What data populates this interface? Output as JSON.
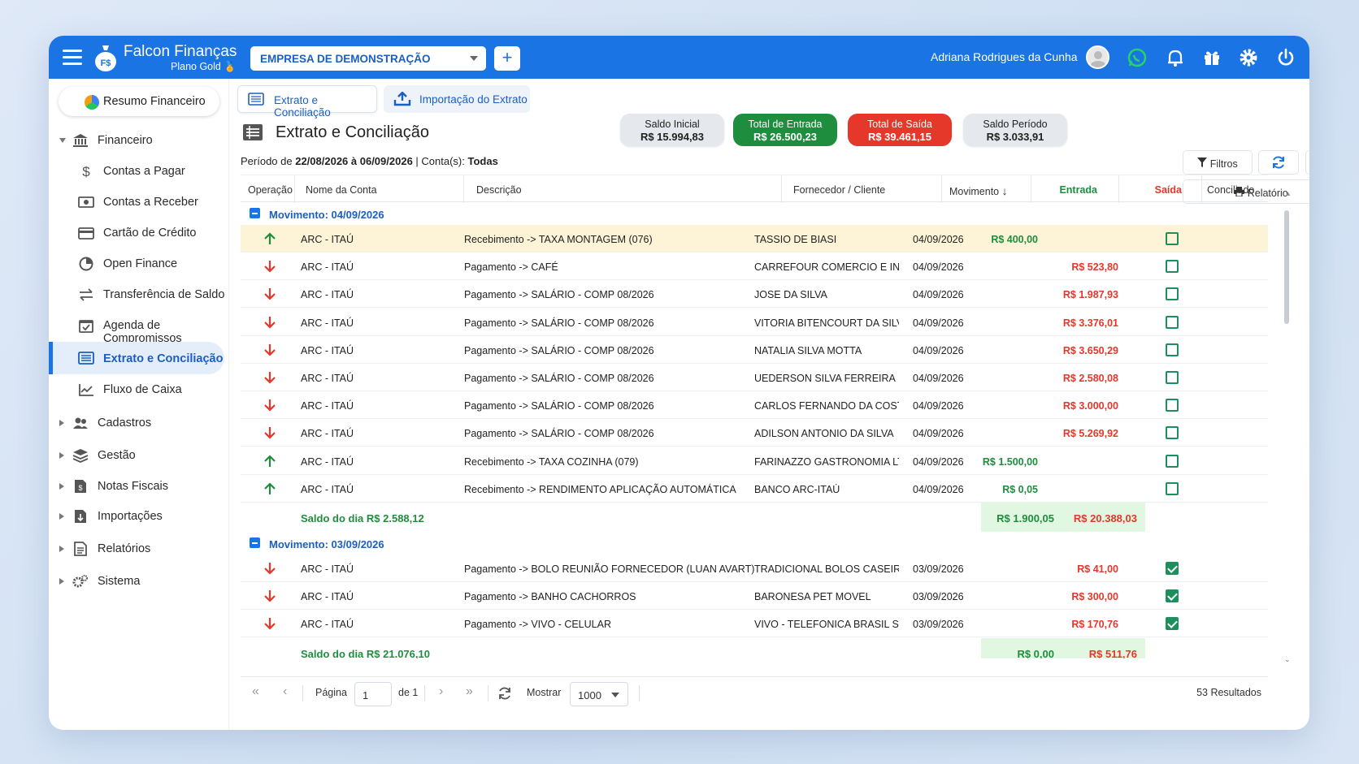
{
  "app": {
    "brand": "Falcon Finanças",
    "plan": "Plano Gold",
    "company": "EMPRESA DE DEMONSTRAÇÃO",
    "add": "+",
    "user": "Adriana Rodrigues da Cunha"
  },
  "sidebar": {
    "resumo": "Resumo Financeiro",
    "financeiro": "Financeiro",
    "items": [
      "Contas a Pagar",
      "Contas a Receber",
      "Cartão de Crédito",
      "Open Finance",
      "Transferência de Saldo",
      "Agenda de Compromissos",
      "Extrato e Conciliação",
      "Fluxo de Caixa"
    ],
    "groups": [
      "Cadastros",
      "Gestão",
      "Notas Fiscais",
      "Importações",
      "Relatórios",
      "Sistema"
    ]
  },
  "tabs": [
    "Extrato e Conciliação",
    "Importação do Extrato"
  ],
  "page": {
    "title": "Extrato e Conciliação",
    "period_prefix": "Período de ",
    "period_range": "22/08/2026 à 06/09/2026",
    "accounts_prefix": " | Conta(s): ",
    "accounts": "Todas"
  },
  "summary": {
    "saldo_inicial_label": "Saldo Inicial",
    "saldo_inicial": "R$ 15.994,83",
    "entrada_label": "Total de Entrada",
    "entrada": "R$ 26.500,23",
    "saida_label": "Total de Saída",
    "saida": "R$ 39.461,15",
    "periodo_label": "Saldo Período",
    "periodo": "R$ 3.033,91"
  },
  "toolbar": {
    "filtros": "Filtros",
    "relatorio": "Relatório"
  },
  "columns": {
    "operacao": "Operação",
    "conta": "Nome da Conta",
    "descricao": "Descrição",
    "fornecedor": "Fornecedor / Cliente",
    "movimento": "Movimento",
    "entrada": "Entrada",
    "saida": "Saída",
    "conciliado": "Conciliado"
  },
  "groups": [
    {
      "label": "Movimento: 04/09/2026",
      "rows": [
        {
          "op": "in",
          "conta": "ARC - ITAÚ",
          "desc": "Recebimento -> TAXA MONTAGEM (076)",
          "cliente": "TASSIO DE BIASI",
          "data": "04/09/2026",
          "entrada": "R$ 400,00",
          "saida": "",
          "conciliado": false,
          "highlight": true
        },
        {
          "op": "out",
          "conta": "ARC - ITAÚ",
          "desc": "Pagamento -> CAFÉ",
          "cliente": "CARREFOUR COMERCIO E INDUSTF",
          "data": "04/09/2026",
          "entrada": "",
          "saida": "R$ 523,80",
          "conciliado": false
        },
        {
          "op": "out",
          "conta": "ARC - ITAÚ",
          "desc": "Pagamento -> SALÁRIO - COMP 08/2026",
          "cliente": "JOSE DA SILVA",
          "data": "04/09/2026",
          "entrada": "",
          "saida": "R$ 1.987,93",
          "conciliado": false
        },
        {
          "op": "out",
          "conta": "ARC - ITAÚ",
          "desc": "Pagamento -> SALÁRIO - COMP 08/2026",
          "cliente": "VITORIA BITENCOURT DA SILVA",
          "data": "04/09/2026",
          "entrada": "",
          "saida": "R$ 3.376,01",
          "conciliado": false
        },
        {
          "op": "out",
          "conta": "ARC - ITAÚ",
          "desc": "Pagamento -> SALÁRIO - COMP 08/2026",
          "cliente": "NATALIA SILVA MOTTA",
          "data": "04/09/2026",
          "entrada": "",
          "saida": "R$ 3.650,29",
          "conciliado": false
        },
        {
          "op": "out",
          "conta": "ARC - ITAÚ",
          "desc": "Pagamento -> SALÁRIO - COMP 08/2026",
          "cliente": "UEDERSON SILVA FERREIRA",
          "data": "04/09/2026",
          "entrada": "",
          "saida": "R$ 2.580,08",
          "conciliado": false
        },
        {
          "op": "out",
          "conta": "ARC - ITAÚ",
          "desc": "Pagamento -> SALÁRIO - COMP 08/2026",
          "cliente": "CARLOS FERNANDO DA COSTA",
          "data": "04/09/2026",
          "entrada": "",
          "saida": "R$ 3.000,00",
          "conciliado": false
        },
        {
          "op": "out",
          "conta": "ARC - ITAÚ",
          "desc": "Pagamento -> SALÁRIO - COMP 08/2026",
          "cliente": "ADILSON ANTONIO DA SILVA",
          "data": "04/09/2026",
          "entrada": "",
          "saida": "R$ 5.269,92",
          "conciliado": false
        },
        {
          "op": "in",
          "conta": "ARC - ITAÚ",
          "desc": "Recebimento -> TAXA COZINHA (079)",
          "cliente": "FARINAZZO GASTRONOMIA LTDA",
          "data": "04/09/2026",
          "entrada": "R$ 1.500,00",
          "saida": "",
          "conciliado": false
        },
        {
          "op": "in",
          "conta": "ARC - ITAÚ",
          "desc": "Recebimento -> RENDIMENTO APLICAÇÃO AUTOMÁTICA",
          "cliente": "BANCO ARC-ITAÚ",
          "data": "04/09/2026",
          "entrada": "R$ 0,05",
          "saida": "",
          "conciliado": false
        }
      ],
      "saldo": "Saldo do dia R$ 2.588,12",
      "total_entrada": "R$ 1.900,05",
      "total_saida": "R$ 20.388,03"
    },
    {
      "label": "Movimento: 03/09/2026",
      "rows": [
        {
          "op": "out",
          "conta": "ARC - ITAÚ",
          "desc": "Pagamento -> BOLO REUNIÃO FORNECEDOR (LUAN AVART)",
          "cliente": "TRADICIONAL BOLOS CASEIROS",
          "data": "03/09/2026",
          "entrada": "",
          "saida": "R$ 41,00",
          "conciliado": true
        },
        {
          "op": "out",
          "conta": "ARC - ITAÚ",
          "desc": "Pagamento -> BANHO CACHORROS",
          "cliente": "BARONESA PET MOVEL",
          "data": "03/09/2026",
          "entrada": "",
          "saida": "R$ 300,00",
          "conciliado": true
        },
        {
          "op": "out",
          "conta": "ARC - ITAÚ",
          "desc": "Pagamento -> VIVO - CELULAR",
          "cliente": "VIVO - TELEFONICA BRASIL S.A.",
          "data": "03/09/2026",
          "entrada": "",
          "saida": "R$ 170,76",
          "conciliado": true
        }
      ],
      "saldo": "Saldo do dia R$ 21.076,10",
      "total_entrada": "R$ 0,00",
      "total_saida": "R$ 511,76"
    }
  ],
  "pager": {
    "page_label": "Página",
    "page": "1",
    "of": "de 1",
    "show_label": "Mostrar",
    "page_size": "1000",
    "results": "53 Resultados"
  },
  "colors": {
    "primary": "#1b74e4",
    "green": "#1e8e3e",
    "red": "#e5372a"
  }
}
